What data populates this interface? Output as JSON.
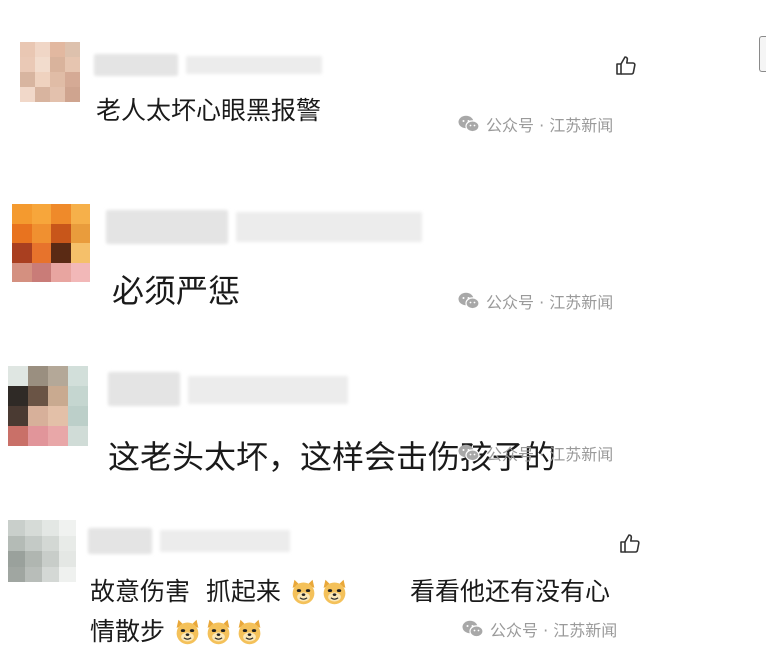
{
  "comments": [
    {
      "text": "老人太坏心眼黑报警",
      "watermark": "公众号 · 江苏新闻",
      "avatar_colors": [
        "#e9c7b3",
        "#f0d6c6",
        "#e2b8a0",
        "#ddc1ad",
        "#eac9b6",
        "#f2dccd",
        "#d9b39c",
        "#e6c5b0",
        "#d8b5a0",
        "#efd2bf",
        "#e0bca6",
        "#d5aa95",
        "#f1d8c9",
        "#d8b49f",
        "#e3c1ad",
        "#cfa48f"
      ]
    },
    {
      "text": "必须严惩",
      "watermark": "公众号 · 江苏新闻",
      "avatar_colors": [
        "#f49a2f",
        "#f7a63b",
        "#ef8a2a",
        "#f6b04a",
        "#e8731f",
        "#f09030",
        "#c8561a",
        "#e99c3c",
        "#a93f20",
        "#e7732c",
        "#5a2a14",
        "#f5c06a",
        "#d49080",
        "#c97c78",
        "#e8a5a0",
        "#f2b8b8"
      ]
    },
    {
      "text": "这老头太坏，这样会击伤孩子的",
      "watermark": "公众号 · 江苏新闻",
      "avatar_colors": [
        "#dfe6e2",
        "#9a8f80",
        "#b4a898",
        "#d2dfda",
        "#2f2a26",
        "#6a5445",
        "#c9aa90",
        "#c5d6d0",
        "#4a3a32",
        "#d7b09a",
        "#e3c0a8",
        "#bccfc9",
        "#c97068",
        "#e1959a",
        "#e8a7a8",
        "#d0dcd7"
      ]
    },
    {
      "text_line1": "故意伤害  抓起来",
      "text_line1b": "看看他还有没有心",
      "text_line2": "情散步",
      "watermark": "公众号 · 江苏新闻",
      "avatar_colors": [
        "#c9cfcb",
        "#d6dbd7",
        "#e3e7e4",
        "#f0f2f0",
        "#b4bbb6",
        "#c4cac6",
        "#d3d8d4",
        "#e8ebe8",
        "#9aa19c",
        "#b0b6b1",
        "#c8cdc9",
        "#e4e7e4",
        "#a0a6a1",
        "#b8bdb9",
        "#d4d8d5",
        "#eff1ef"
      ]
    }
  ],
  "icons": {
    "thumb": "thumbs-up-icon",
    "wechat": "wechat-icon",
    "emoji": "doge-emoji-icon"
  }
}
